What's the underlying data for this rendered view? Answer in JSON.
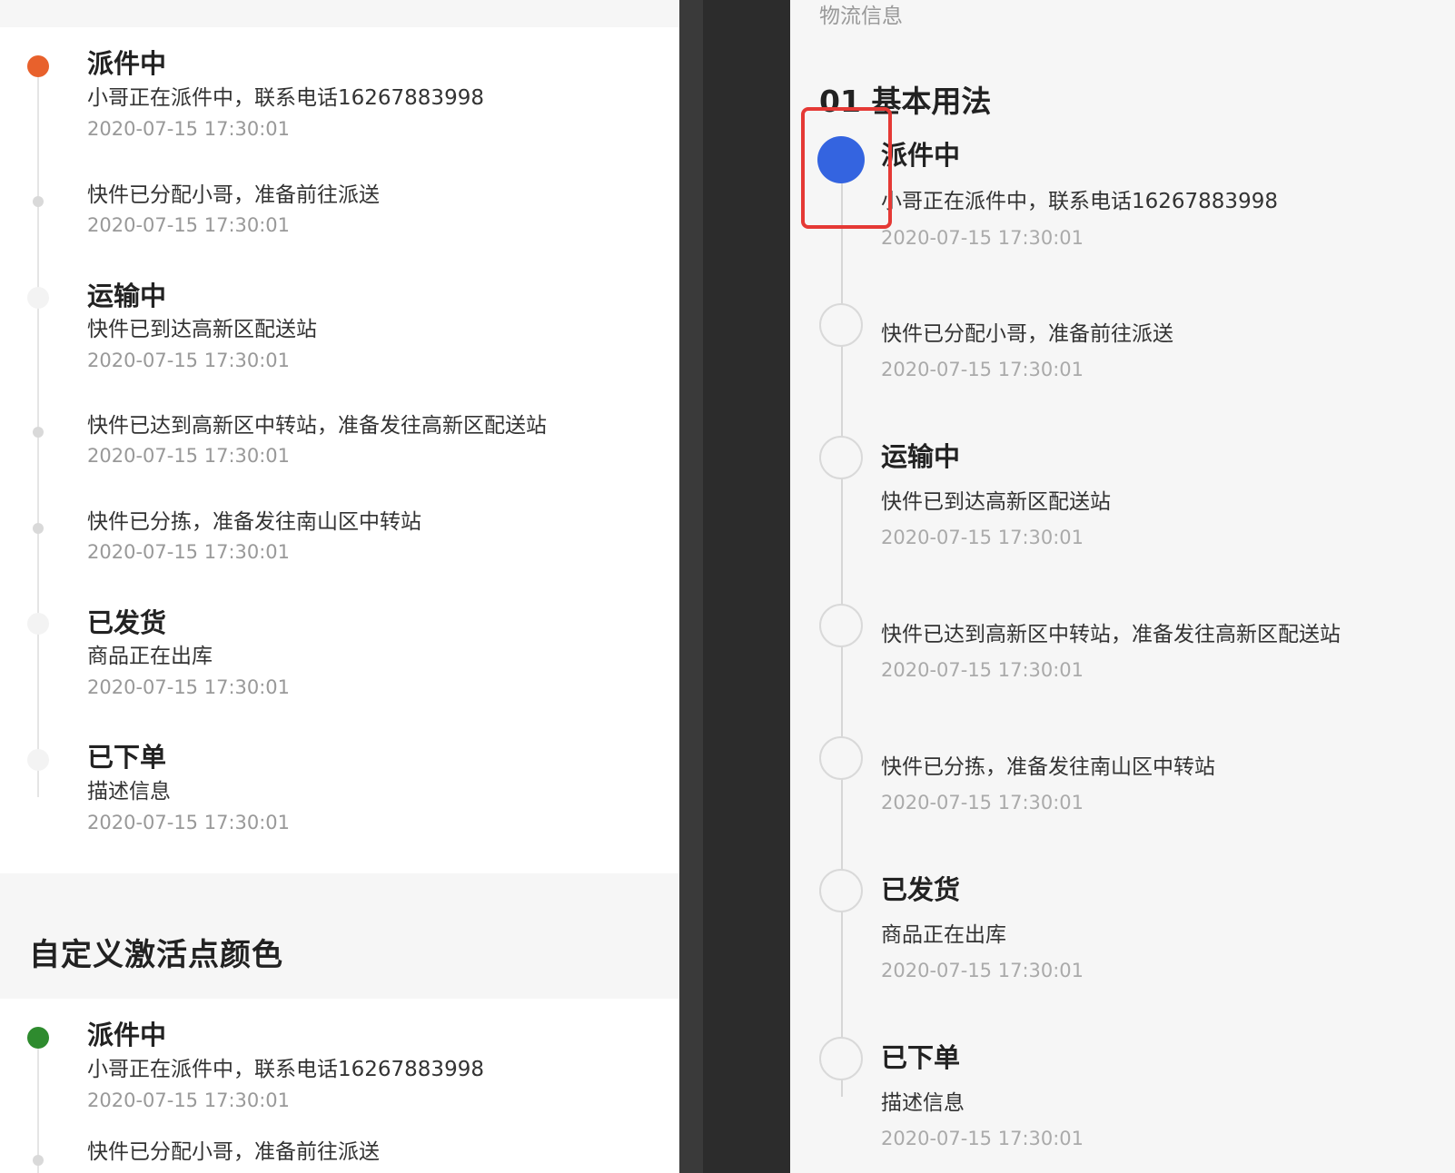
{
  "left": {
    "section_title": "自定义激活点颜色",
    "timeline1": {
      "items": [
        {
          "title": "派件中",
          "content": "小哥正在派件中，联系电话16267883998",
          "time": "2020-07-15 17:30:01"
        },
        {
          "title": "",
          "content": "快件已分配小哥，准备前往派送",
          "time": "2020-07-15 17:30:01"
        },
        {
          "title": "运输中",
          "content": "快件已到达高新区配送站",
          "time": "2020-07-15 17:30:01"
        },
        {
          "title": "",
          "content": "快件已达到高新区中转站，准备发往高新区配送站",
          "time": "2020-07-15 17:30:01"
        },
        {
          "title": "",
          "content": "快件已分拣，准备发往南山区中转站",
          "time": "2020-07-15 17:30:01"
        },
        {
          "title": "已发货",
          "content": "商品正在出库",
          "time": "2020-07-15 17:30:01"
        },
        {
          "title": "已下单",
          "content": "描述信息",
          "time": "2020-07-15 17:30:01"
        }
      ]
    },
    "timeline2": {
      "items": [
        {
          "title": "派件中",
          "content": "小哥正在派件中，联系电话16267883998",
          "time": "2020-07-15 17:30:01"
        },
        {
          "title": "",
          "content": "快件已分配小哥，准备前往派送",
          "time": ""
        }
      ]
    }
  },
  "right": {
    "header": "物流信息",
    "section_title": "01 基本用法",
    "items": [
      {
        "title": "派件中",
        "content": "小哥正在派件中，联系电话16267883998",
        "time": "2020-07-15 17:30:01"
      },
      {
        "title": "",
        "content": "快件已分配小哥，准备前往派送",
        "time": "2020-07-15 17:30:01"
      },
      {
        "title": "运输中",
        "content": "快件已到达高新区配送站",
        "time": "2020-07-15 17:30:01"
      },
      {
        "title": "",
        "content": "快件已达到高新区中转站，准备发往高新区配送站",
        "time": "2020-07-15 17:30:01"
      },
      {
        "title": "",
        "content": "快件已分拣，准备发往南山区中转站",
        "time": "2020-07-15 17:30:01"
      },
      {
        "title": "已发货",
        "content": "商品正在出库",
        "time": "2020-07-15 17:30:01"
      },
      {
        "title": "已下单",
        "content": "描述信息",
        "time": "2020-07-15 17:30:01"
      }
    ]
  },
  "colors": {
    "active_orange": "#e8612c",
    "active_green": "#2e8b2e",
    "active_blue": "#3464e0",
    "highlight_red": "#e53935"
  }
}
